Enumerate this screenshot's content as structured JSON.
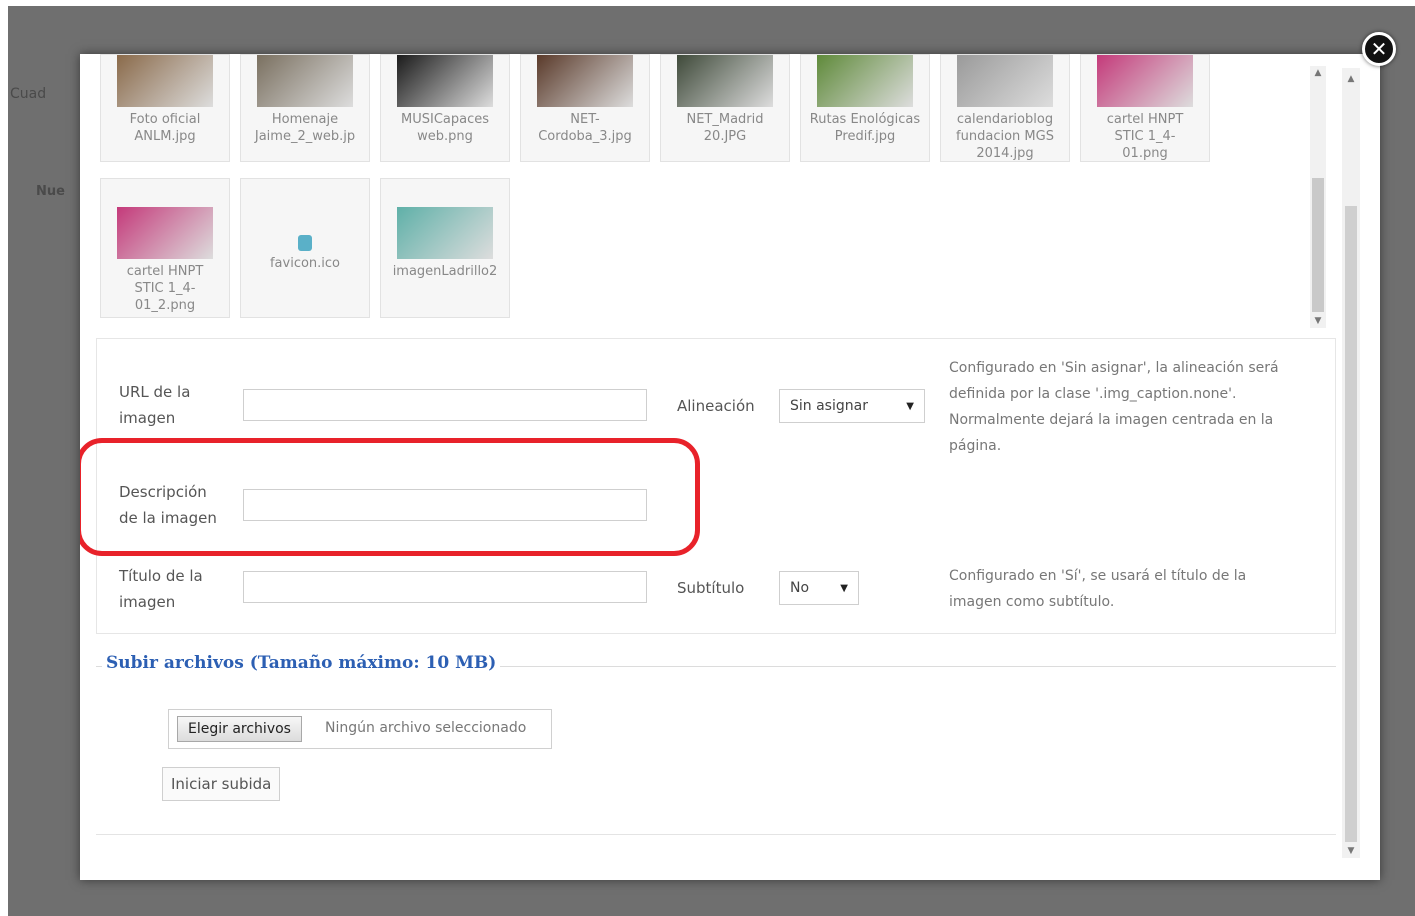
{
  "background": {
    "fragment_1": "Cuad",
    "fragment_2": "Nue"
  },
  "close_label": "✕",
  "gallery": {
    "row1": [
      {
        "caption": "Foto oficial\nANLM.jpg",
        "color": "#8a6a4a"
      },
      {
        "caption": "Homenaje\nJaime_2_web.jp",
        "color": "#7a7060"
      },
      {
        "caption": "MUSICapaces\nweb.png",
        "color": "#1b1b1b"
      },
      {
        "caption": "NET-\nCordoba_3.jpg",
        "color": "#5a3a2a"
      },
      {
        "caption": "NET_Madrid\n20.JPG",
        "color": "#3f4a3a"
      },
      {
        "caption": "Rutas Enológicas\nPredif.jpg",
        "color": "#5f8a3a"
      },
      {
        "caption": "calendarioblog\nfundacion MGS\n2014.jpg",
        "color": "#9a9a9a"
      },
      {
        "caption": "cartel HNPT\nSTIC 1_4-\n01.png",
        "color": "#c43a7a"
      }
    ],
    "row2": [
      {
        "caption": "cartel HNPT\nSTIC 1_4-\n01_2.png",
        "color": "#c43a7a"
      },
      {
        "caption": "favicon.ico",
        "color": "#5ab0c8"
      },
      {
        "caption": "imagenLadrillo2",
        "color": "#5fb0a8"
      }
    ]
  },
  "form": {
    "url_label": "URL de la\nimagen",
    "url_value": "",
    "alignment_label": "Alineación",
    "alignment_value": "Sin asignar",
    "alignment_help_1": "Configurado en 'Sin asignar', la alineación será",
    "alignment_help_2": "definida por la clase '.img_caption.none'.",
    "alignment_help_3": "Normalmente dejará la imagen centrada en la",
    "alignment_help_4": "página.",
    "desc_label": "Descripción\nde la imagen",
    "desc_value": "",
    "title_label": "Título de la\nimagen",
    "title_value": "",
    "subtitle_label": "Subtítulo",
    "subtitle_value": "No",
    "subtitle_help_1": "Configurado en 'Sí', se usará el título de la",
    "subtitle_help_2": "imagen como subtítulo."
  },
  "upload": {
    "legend": "Subir archivos (Tamaño máximo: 10 MB)",
    "choose_label": "Elegir archivos",
    "no_file_label": "Ningún archivo seleccionado",
    "start_label": "Iniciar subida"
  },
  "colors": {
    "highlight": "#e8222a",
    "legend": "#2c5fb3"
  }
}
